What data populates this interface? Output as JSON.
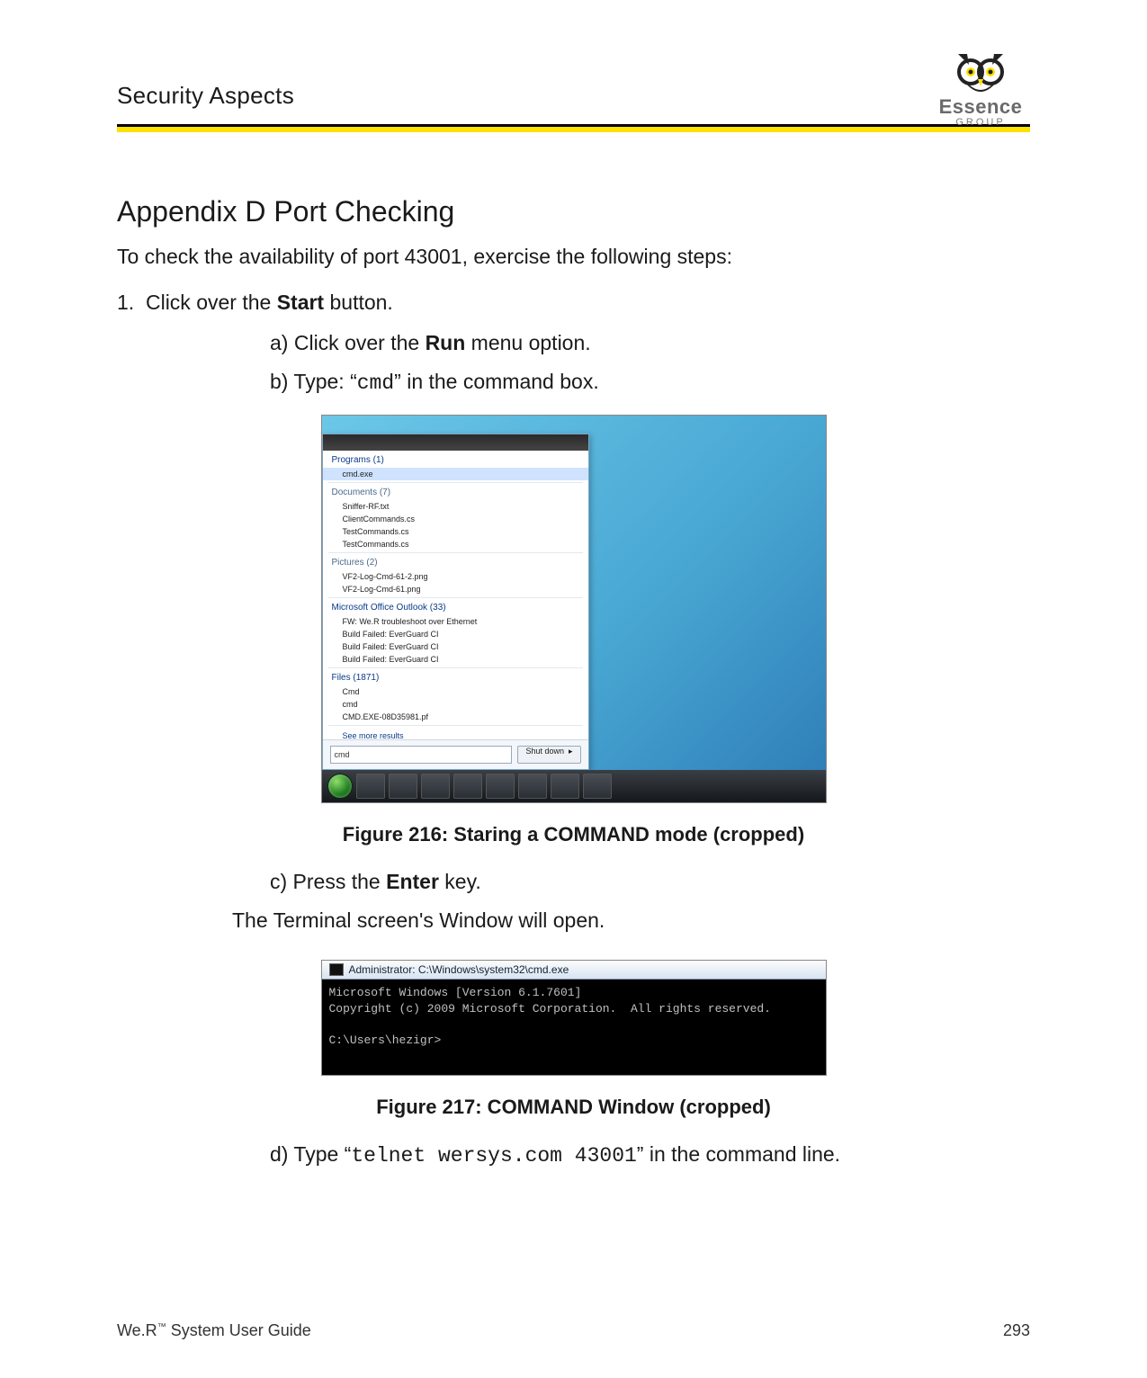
{
  "header": {
    "section_title": "Security Aspects"
  },
  "logo": {
    "brand": "Essence",
    "sub": "GROUP"
  },
  "title": "Appendix D    Port Checking",
  "intro": "To check the availability of port 43001, exercise the following steps:",
  "step1": {
    "num": "1.",
    "pre": "Click over the ",
    "bold": "Start",
    "post": " button."
  },
  "sub_a": {
    "label": "a)",
    "pre": " Click over the ",
    "bold": "Run",
    "post": " menu option."
  },
  "sub_b": {
    "label": "b)",
    "pre": " Type: “",
    "mono": "cmd",
    "post": "” in the command box."
  },
  "fig216": {
    "caption": "Figure 216: Staring a COMMAND mode (cropped)",
    "startmenu": {
      "programs_hdr": "Programs (1)",
      "programs": [
        "cmd.exe"
      ],
      "documents_hdr": "Documents (7)",
      "documents": [
        "Sniffer-RF.txt",
        "ClientCommands.cs",
        "TestCommands.cs",
        "TestCommands.cs"
      ],
      "pictures_hdr": "Pictures (2)",
      "pictures": [
        "VF2-Log-Cmd-61-2.png",
        "VF2-Log-Cmd-61.png"
      ],
      "outlook_hdr": "Microsoft Office Outlook (33)",
      "outlook": [
        "FW: We.R troubleshoot over Ethernet",
        "Build Failed: EverGuard CI",
        "Build Failed: EverGuard CI",
        "Build Failed: EverGuard CI"
      ],
      "files_hdr": "Files (1871)",
      "files": [
        "Cmd",
        "cmd",
        "CMD.EXE-08D35981.pf"
      ],
      "see_more": "See more results",
      "search_value": "cmd",
      "shutdown": "Shut down"
    }
  },
  "sub_c": {
    "label": "c)",
    "pre": " Press the ",
    "bold": "Enter",
    "post": " key."
  },
  "after_c": "The Terminal screen's Window will open.",
  "fig217": {
    "caption": "Figure 217: COMMAND Window (cropped)",
    "title": "Administrator: C:\\Windows\\system32\\cmd.exe",
    "line1": "Microsoft Windows [Version 6.1.7601]",
    "line2": "Copyright (c) 2009 Microsoft Corporation.  All rights reserved.",
    "prompt": "C:\\Users\\hezigr>"
  },
  "sub_d": {
    "label": "d)",
    "pre": " Type “",
    "mono": "telnet wersys.com 43001",
    "post": "” in the command line."
  },
  "footer": {
    "left_pre": "We.R",
    "left_tm": "™",
    "left_post": " System User Guide",
    "page": "293"
  }
}
